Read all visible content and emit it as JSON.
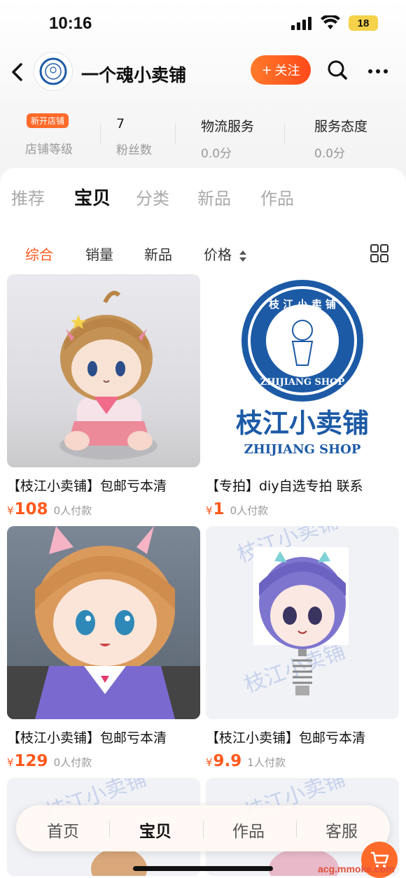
{
  "status_bar": {
    "time": "10:16",
    "battery": "18"
  },
  "header": {
    "shop_name": "一个魂小卖铺",
    "follow_label": "关注",
    "follow_plus": "+"
  },
  "stats": [
    {
      "value": "新开店铺",
      "label": "店铺等级"
    },
    {
      "value": "7",
      "label": "粉丝数"
    },
    {
      "value": "物流服务",
      "label": "0.0分"
    },
    {
      "value": "服务态度",
      "label": "0.0分"
    }
  ],
  "tabs": [
    "推荐",
    "宝贝",
    "分类",
    "新品",
    "作品"
  ],
  "filters": [
    "综合",
    "销量",
    "新品",
    "价格"
  ],
  "products": [
    {
      "title": "【枝江小卖铺】包邮亏本清",
      "yen": "¥",
      "price": "108",
      "paid": "0人付款"
    },
    {
      "title": "【专拍】diy自选专拍 联系",
      "yen": "¥",
      "price": "1",
      "paid": "0人付款"
    },
    {
      "title": "【枝江小卖铺】包邮亏本清",
      "yen": "¥",
      "price": "129",
      "paid": "0人付款"
    },
    {
      "title": "【枝江小卖铺】包邮亏本清",
      "yen": "¥",
      "price": "9.9",
      "paid": "1人付款"
    }
  ],
  "logo_text": {
    "cn": "枝江小卖铺",
    "en": "ZHIJIANG SHOP",
    "ring_cn": "枝 江 小 卖 铺"
  },
  "watermark_text": "枝江小卖铺",
  "bottom_nav": [
    "首页",
    "宝贝",
    "作品",
    "客服"
  ],
  "site_watermark": "acg.mmoke.com",
  "colors": {
    "accent": "#ff5a1e",
    "logo_blue": "#1c5aa6"
  }
}
